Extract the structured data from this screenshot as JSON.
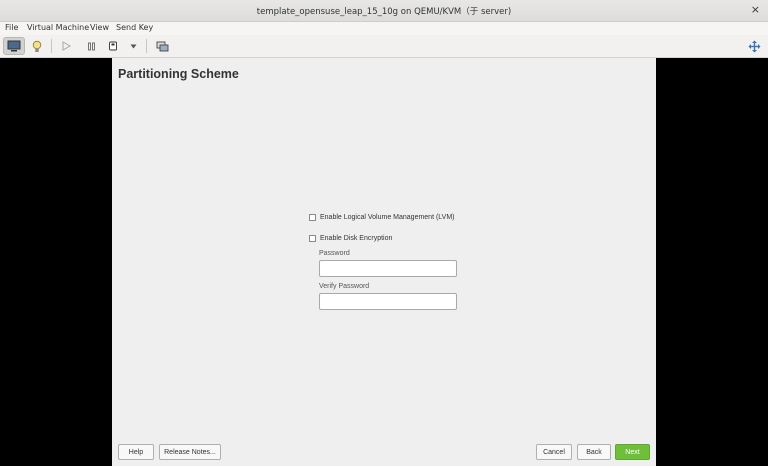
{
  "window": {
    "title": "template_opensuse_leap_15_10g on QEMU/KVM（于 server)",
    "close_glyph": "×"
  },
  "menu": {
    "file": "File",
    "virtual_machine": "Virtual Machine",
    "view": "View",
    "send_key": "Send Key"
  },
  "toolbar": {
    "icons": [
      "monitor-icon",
      "lightbulb-icon",
      "play-icon",
      "pause-icon",
      "power-icon",
      "dropdown-arrow-icon",
      "snapshots-icon",
      "fullscreen-icon"
    ]
  },
  "installer": {
    "title": "Partitioning Scheme",
    "lvm_label": "Enable Logical Volume Management (LVM)",
    "encryption_label": "Enable Disk Encryption",
    "password_label": "Password",
    "verify_password_label": "Verify Password",
    "password_value": "",
    "verify_password_value": "",
    "buttons": {
      "help": "Help",
      "release_notes": "Release Notes...",
      "cancel": "Cancel",
      "back": "Back",
      "next": "Next"
    },
    "accent_color": "#6fbf3a"
  }
}
